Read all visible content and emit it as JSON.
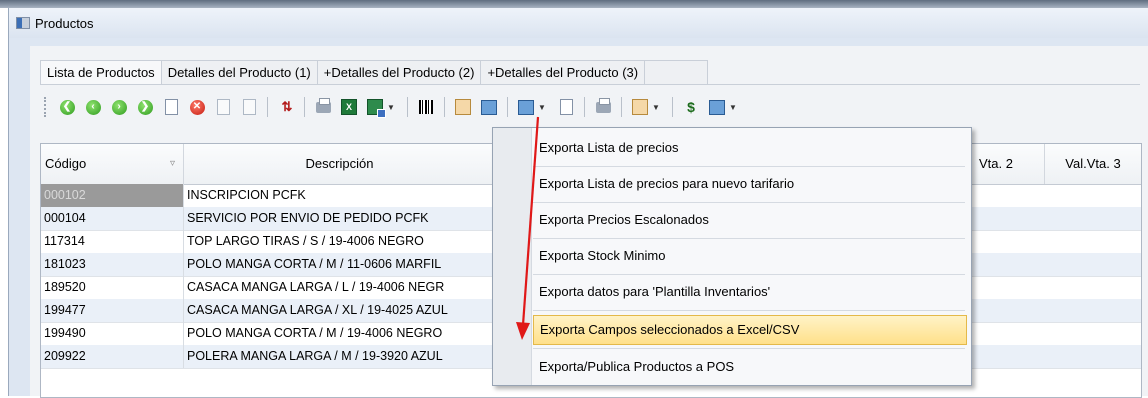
{
  "window": {
    "title": "Productos"
  },
  "tabs": [
    {
      "label": "Lista de Productos"
    },
    {
      "label": "Detalles del Producto (1)"
    },
    {
      "label": "+Detalles del Producto (2)"
    },
    {
      "label": "+Detalles del Producto (3)"
    }
  ],
  "table": {
    "headers": {
      "codigo": "Código",
      "descripcion": "Descripción",
      "valvta2": "Vta. 2",
      "valvta3": "Val.Vta. 3"
    },
    "rows": [
      {
        "codigo": "000102",
        "descripcion": "INSCRIPCION PCFK"
      },
      {
        "codigo": "000104",
        "descripcion": "SERVICIO POR ENVIO DE PEDIDO PCFK"
      },
      {
        "codigo": "117314",
        "descripcion": "TOP LARGO TIRAS / S / 19-4006 NEGRO"
      },
      {
        "codigo": "181023",
        "descripcion": "POLO MANGA CORTA / M / 11-0606 MARFIL"
      },
      {
        "codigo": "189520",
        "descripcion": "CASACA MANGA LARGA / L / 19-4006 NEGR"
      },
      {
        "codigo": "199477",
        "descripcion": "CASACA MANGA LARGA / XL / 19-4025 AZUL"
      },
      {
        "codigo": "199490",
        "descripcion": "POLO MANGA CORTA / M / 19-4006 NEGRO"
      },
      {
        "codigo": "209922",
        "descripcion": "POLERA MANGA LARGA / M / 19-3920 AZUL"
      }
    ]
  },
  "menu": {
    "items": [
      {
        "label": "Exporta Lista de precios"
      },
      {
        "label": "Exporta Lista de precios para nuevo tarifario"
      },
      {
        "label": "Exporta Precios Escalonados"
      },
      {
        "label": "Exporta Stock Minimo"
      },
      {
        "label": "Exporta datos para 'Plantilla Inventarios'"
      },
      {
        "label": "Exporta Campos seleccionados a Excel/CSV"
      },
      {
        "label": "Exporta/Publica Productos a POS"
      }
    ],
    "highlighted_index": 5
  },
  "colors": {
    "highlight": "#ffe08a",
    "annotation_arrow": "#e01818",
    "selected_cell": "#9a9a9a"
  },
  "toolbar_icons": [
    "first-icon",
    "previous-icon",
    "next-icon",
    "last-icon",
    "new-document-icon",
    "delete-icon",
    "copy-icon",
    "paste-icon",
    "swap-icon",
    "print-icon",
    "excel-icon",
    "excel-export-icon",
    "barcode-icon",
    "grid-icon",
    "table-icon",
    "transfer-icon",
    "form-icon",
    "tool-icon",
    "search-icon",
    "price-icon",
    "table-options-icon"
  ]
}
